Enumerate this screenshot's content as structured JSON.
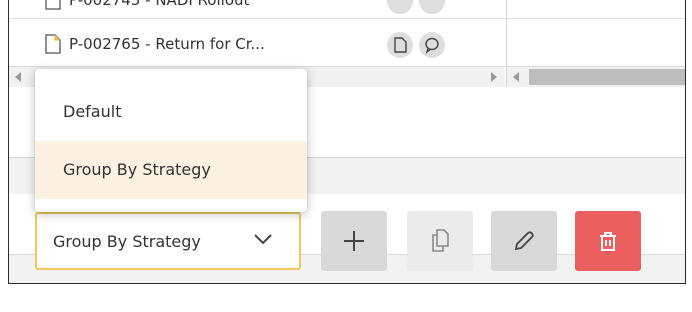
{
  "grid": {
    "rows": [
      {
        "text": "P-002745 - NADI Rollout"
      },
      {
        "text": "P-002765 - Return for Cr..."
      }
    ]
  },
  "group_by": {
    "selected": "Group By Strategy",
    "options": [
      "Default",
      "Group By Strategy"
    ],
    "highlighted_index": 1
  },
  "toolbar": {
    "buttons": [
      {
        "name": "add-button",
        "icon": "plus-icon",
        "enabled": true
      },
      {
        "name": "copy-button",
        "icon": "copy-icon",
        "enabled": false
      },
      {
        "name": "edit-button",
        "icon": "pencil-icon",
        "enabled": true
      },
      {
        "name": "delete-button",
        "icon": "trash-icon",
        "enabled": true
      }
    ]
  },
  "colors": {
    "accent": "#f0c75e",
    "highlight": "#fdf1e2",
    "danger": "#ec5f5f",
    "button_gray": "#d9d9d9",
    "button_disabled": "#ebebeb"
  }
}
